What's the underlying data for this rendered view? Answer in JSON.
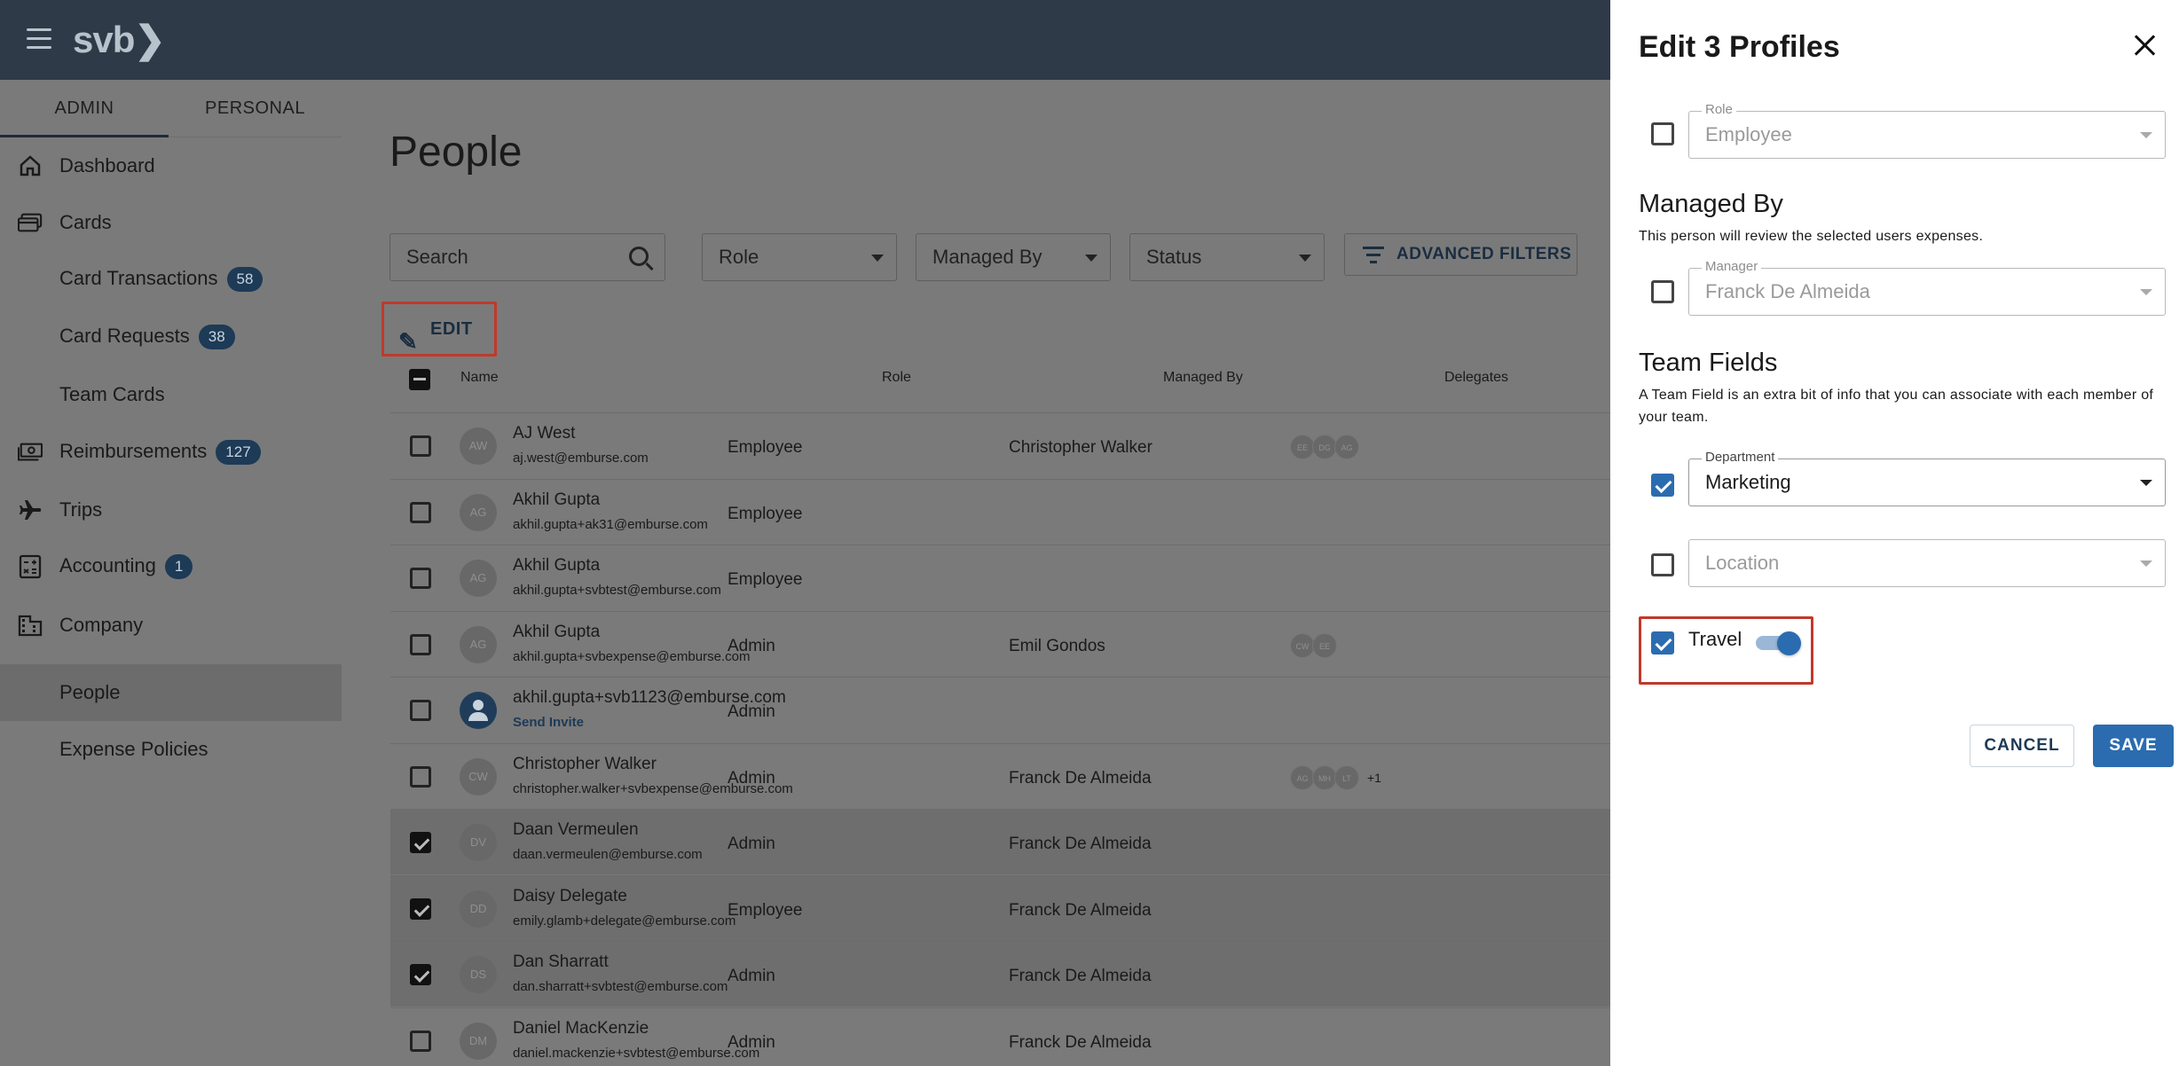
{
  "topbar": {
    "logo": "svb❯"
  },
  "sidebar": {
    "tabs": [
      {
        "label": "ADMIN"
      },
      {
        "label": "PERSONAL"
      }
    ],
    "items": [
      {
        "label": "Dashboard",
        "icon": "home-icon"
      },
      {
        "label": "Cards",
        "icon": "cards-icon"
      },
      {
        "label": "Card Transactions",
        "badge": "58"
      },
      {
        "label": "Card Requests",
        "badge": "38"
      },
      {
        "label": "Team Cards"
      },
      {
        "label": "Reimbursements",
        "badge": "127",
        "icon": "cash-icon"
      },
      {
        "label": "Trips",
        "icon": "plane-icon"
      },
      {
        "label": "Accounting",
        "badge": "1",
        "icon": "accounting-icon"
      },
      {
        "label": "Company",
        "icon": "building-icon"
      },
      {
        "label": "People",
        "active": true
      },
      {
        "label": "Expense Policies"
      }
    ]
  },
  "main": {
    "title": "People",
    "search_placeholder": "Search",
    "filters": {
      "role": "Role",
      "managed_by": "Managed By",
      "status": "Status"
    },
    "advanced_filters": "ADVANCED FILTERS",
    "edit_label": "EDIT",
    "columns": {
      "name": "Name",
      "role": "Role",
      "managed_by": "Managed By",
      "delegates": "Delegates"
    },
    "rows": [
      {
        "initials": "AW",
        "name": "AJ West",
        "email": "aj.west@emburse.com",
        "role": "Employee",
        "manager": "Christopher Walker",
        "delegates": [
          "EE",
          "DG",
          "AG"
        ],
        "more": "",
        "checked": false
      },
      {
        "initials": "AG",
        "name": "Akhil Gupta",
        "email": "akhil.gupta+ak31@emburse.com",
        "role": "Employee",
        "manager": "",
        "delegates": [],
        "more": "",
        "checked": false
      },
      {
        "initials": "AG",
        "name": "Akhil Gupta",
        "email": "akhil.gupta+svbtest@emburse.com",
        "role": "Employee",
        "manager": "",
        "delegates": [],
        "more": "",
        "checked": false
      },
      {
        "initials": "AG",
        "name": "Akhil Gupta",
        "email": "akhil.gupta+svbexpense@emburse.com",
        "role": "Admin",
        "manager": "Emil Gondos",
        "delegates": [
          "CW",
          "EE"
        ],
        "more": "",
        "checked": false
      },
      {
        "initials": "",
        "name": "akhil.gupta+svb1123@emburse.com",
        "email": "Send Invite",
        "role": "Admin",
        "manager": "",
        "delegates": [],
        "more": "",
        "checked": false,
        "invite": true
      },
      {
        "initials": "CW",
        "name": "Christopher Walker",
        "email": "christopher.walker+svbexpense@emburse.com",
        "role": "Admin",
        "manager": "Franck De Almeida",
        "delegates": [
          "AG",
          "MH",
          "LT"
        ],
        "more": "+1",
        "checked": false
      },
      {
        "initials": "DV",
        "name": "Daan Vermeulen",
        "email": "daan.vermeulen@emburse.com",
        "role": "Admin",
        "manager": "Franck De Almeida",
        "delegates": [],
        "more": "",
        "checked": true
      },
      {
        "initials": "DD",
        "name": "Daisy Delegate",
        "email": "emily.glamb+delegate@emburse.com",
        "role": "Employee",
        "manager": "Franck De Almeida",
        "delegates": [],
        "more": "",
        "checked": true
      },
      {
        "initials": "DS",
        "name": "Dan Sharratt",
        "email": "dan.sharratt+svbtest@emburse.com",
        "role": "Admin",
        "manager": "Franck De Almeida",
        "delegates": [],
        "more": "",
        "checked": true
      },
      {
        "initials": "DM",
        "name": "Daniel MacKenzie",
        "email": "daniel.mackenzie+svbtest@emburse.com",
        "role": "Admin",
        "manager": "Franck De Almeida",
        "delegates": [],
        "more": "",
        "checked": false
      }
    ]
  },
  "drawer": {
    "title": "Edit 3 Profiles",
    "role": {
      "label": "Role",
      "value": "Employee",
      "checked": false
    },
    "managed_by": {
      "heading": "Managed By",
      "description": "This person will review the selected users expenses.",
      "label": "Manager",
      "value": "Franck De Almeida",
      "checked": false
    },
    "team_fields": {
      "heading": "Team Fields",
      "description": "A Team Field is an extra bit of info that you can associate with each member of your team.",
      "department": {
        "label": "Department",
        "value": "Marketing",
        "checked": true
      },
      "location": {
        "placeholder": "Location",
        "checked": false
      },
      "travel": {
        "label": "Travel",
        "checked": true,
        "toggle_on": true
      }
    },
    "cancel_label": "CANCEL",
    "save_label": "SAVE"
  }
}
